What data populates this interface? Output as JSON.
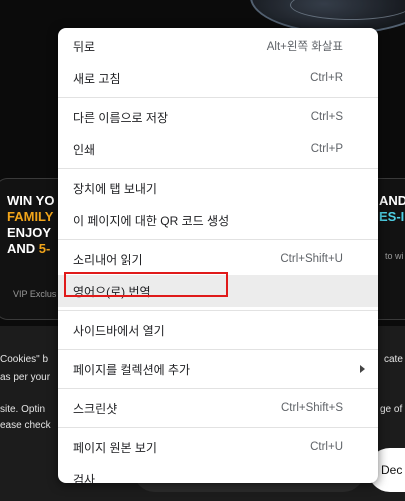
{
  "background": {
    "promo": {
      "lines": [
        {
          "text": "WIN YO",
          "highlight": ""
        },
        {
          "text": "",
          "highlight": "FAMILY"
        },
        {
          "text": "ENJOY",
          "highlight": ""
        },
        {
          "text": "AND ",
          "highlight": "5-"
        }
      ],
      "right_lines": [
        "AND",
        "ES-I"
      ],
      "right_small": "to wi",
      "footer": "VIP Exclus"
    },
    "cookie_lines": [
      "Cookies\" b",
      "as per your",
      "site. Optin",
      "ease check"
    ],
    "cookie_right": [
      "cate",
      "ge of"
    ],
    "decline_button": "Dec"
  },
  "menu": {
    "groups": [
      [
        {
          "label": "뒤로",
          "shortcut": "Alt+왼쪽 화살표"
        },
        {
          "label": "새로 고침",
          "shortcut": "Ctrl+R"
        }
      ],
      [
        {
          "label": "다른 이름으로 저장",
          "shortcut": "Ctrl+S"
        },
        {
          "label": "인쇄",
          "shortcut": "Ctrl+P"
        }
      ],
      [
        {
          "label": "장치에 탭 보내기",
          "shortcut": ""
        },
        {
          "label": "이 페이지에 대한 QR 코드 생성",
          "shortcut": ""
        }
      ],
      [
        {
          "label": "소리내어 읽기",
          "shortcut": "Ctrl+Shift+U"
        },
        {
          "label": "영어으(로) 번역",
          "shortcut": "",
          "hovered": true
        }
      ],
      [
        {
          "label": "사이드바에서 열기",
          "shortcut": ""
        }
      ],
      [
        {
          "label": "페이지를 컬렉션에 추가",
          "shortcut": "",
          "submenu": true
        }
      ],
      [
        {
          "label": "스크린샷",
          "shortcut": "Ctrl+Shift+S"
        }
      ],
      [
        {
          "label": "페이지 원본 보기",
          "shortcut": "Ctrl+U"
        },
        {
          "label": "검사",
          "shortcut": ""
        }
      ]
    ],
    "highlight_color": "#e01a1a"
  }
}
